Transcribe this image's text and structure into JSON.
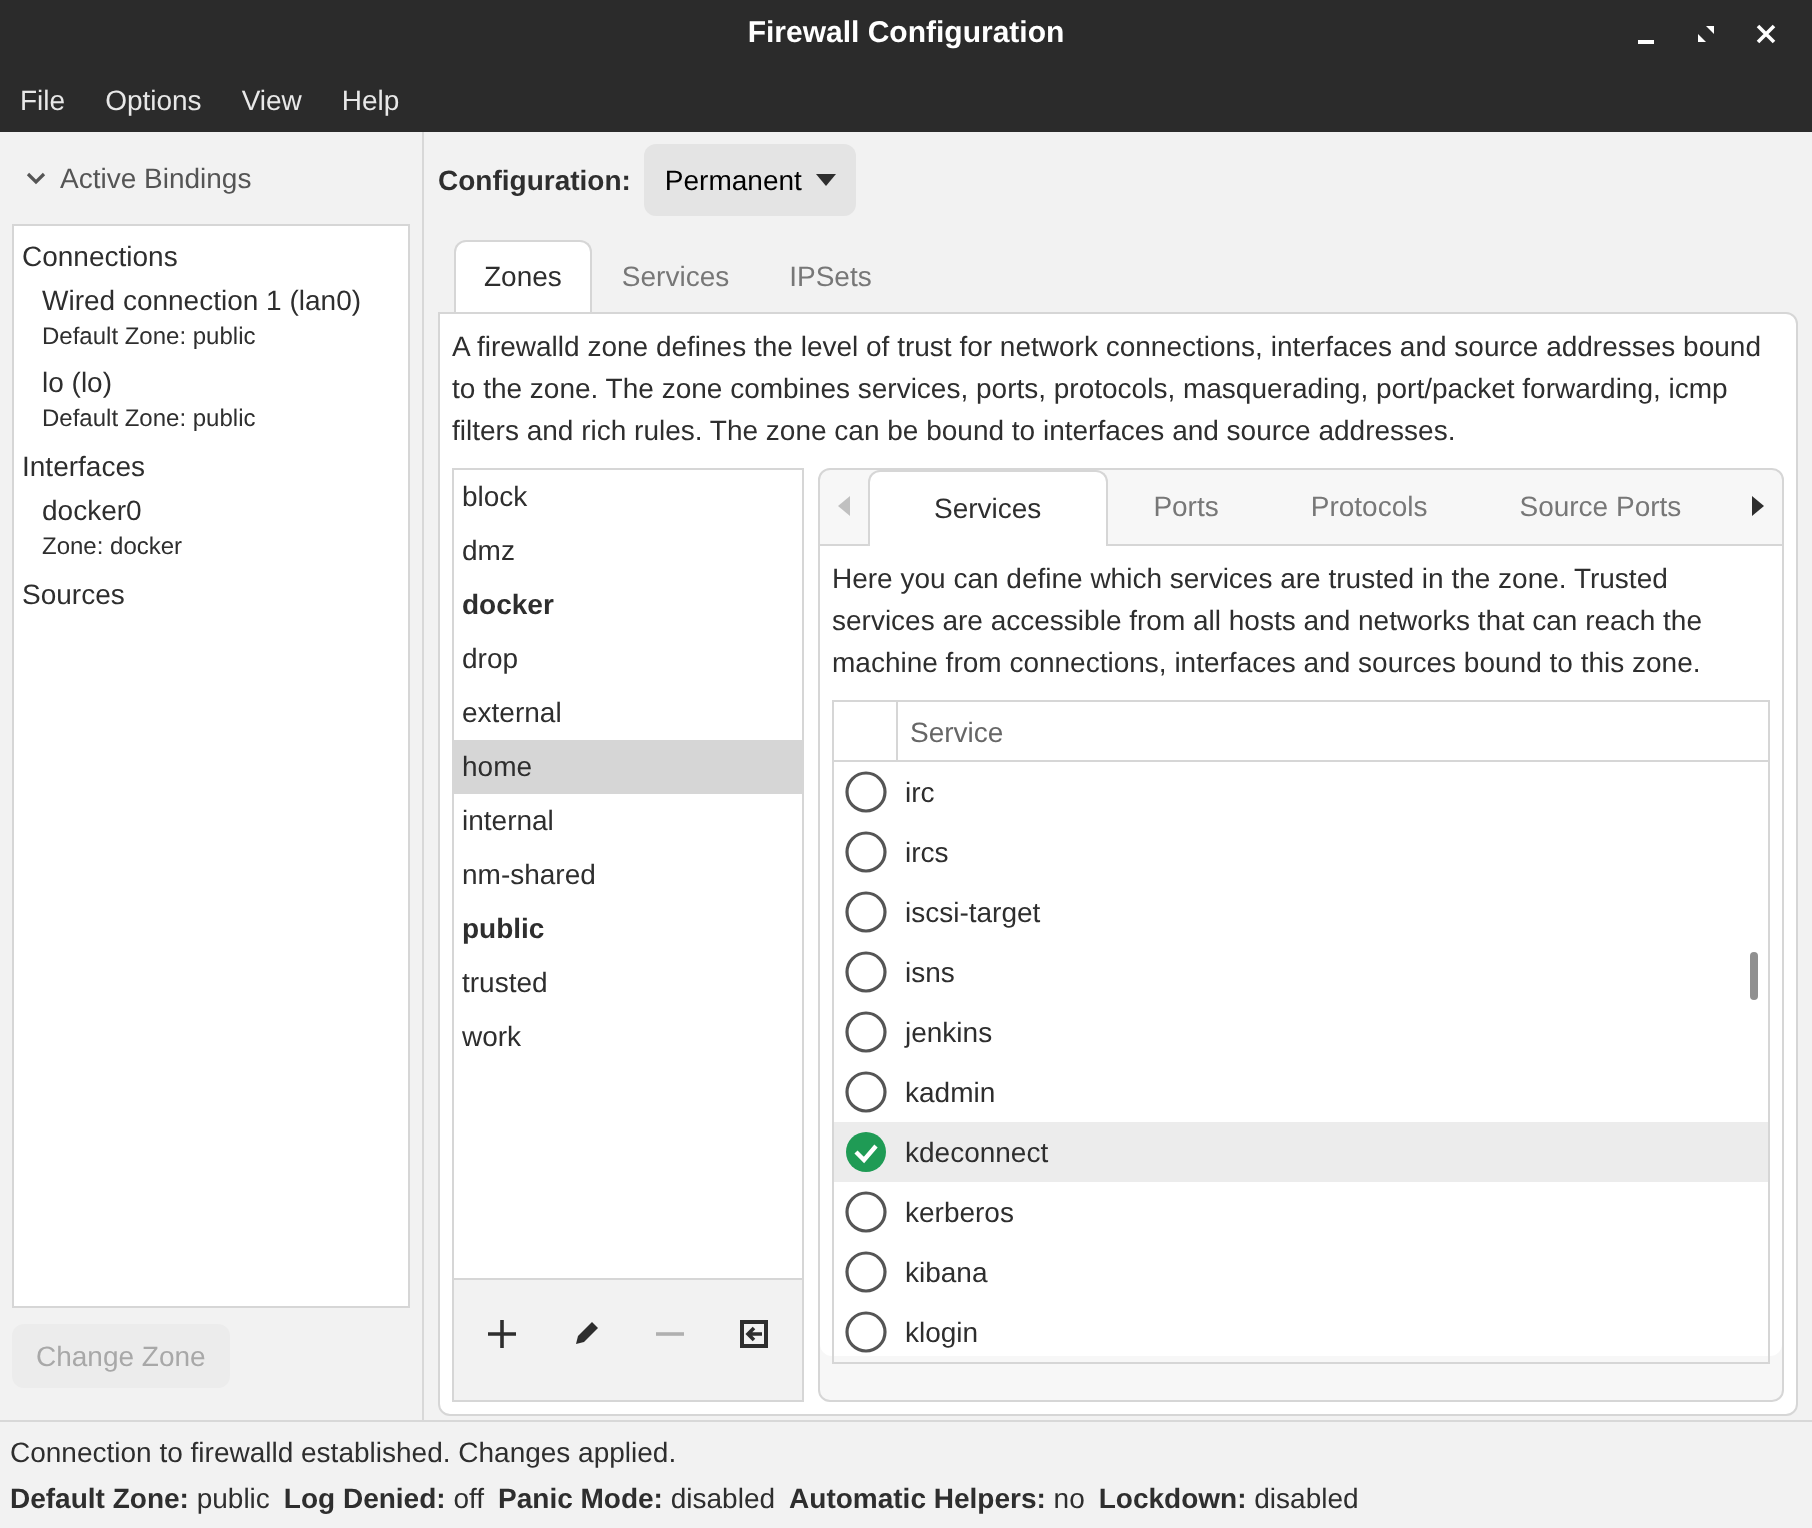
{
  "window": {
    "title": "Firewall Configuration"
  },
  "menu": [
    "File",
    "Options",
    "View",
    "Help"
  ],
  "bindings": {
    "title": "Active Bindings",
    "expanded": true,
    "sections": [
      {
        "heading": "Connections",
        "items": [
          {
            "name": "Wired connection 1 (lan0)",
            "detail": "Default Zone: public"
          },
          {
            "name": "lo (lo)",
            "detail": "Default Zone: public"
          }
        ]
      },
      {
        "heading": "Interfaces",
        "items": [
          {
            "name": "docker0",
            "detail": "Zone: docker"
          }
        ]
      },
      {
        "heading": "Sources"
      }
    ],
    "change_zone_button": {
      "label": "Change Zone",
      "disabled": true
    }
  },
  "configuration": {
    "label": "Configuration:",
    "value": "Permanent"
  },
  "tabs": [
    {
      "label": "Zones",
      "selected": true
    },
    {
      "label": "Services",
      "selected": false
    },
    {
      "label": "IPSets",
      "selected": false
    }
  ],
  "zones_description": "A firewalld zone defines the level of trust for network connections, interfaces and source addresses bound to the zone. The zone combines services, ports, protocols, masquerading, port/packet forwarding, icmp filters and rich rules. The zone can be bound to interfaces and source addresses.",
  "zones": [
    {
      "name": "block",
      "active": false,
      "selected": false
    },
    {
      "name": "dmz",
      "active": false,
      "selected": false
    },
    {
      "name": "docker",
      "active": true,
      "selected": false
    },
    {
      "name": "drop",
      "active": false,
      "selected": false
    },
    {
      "name": "external",
      "active": false,
      "selected": false
    },
    {
      "name": "home",
      "active": false,
      "selected": true
    },
    {
      "name": "internal",
      "active": false,
      "selected": false
    },
    {
      "name": "nm-shared",
      "active": false,
      "selected": false
    },
    {
      "name": "public",
      "active": true,
      "selected": false
    },
    {
      "name": "trusted",
      "active": false,
      "selected": false
    },
    {
      "name": "work",
      "active": false,
      "selected": false
    }
  ],
  "zone_tools": [
    {
      "kind": "add",
      "disabled": false
    },
    {
      "kind": "edit",
      "disabled": false
    },
    {
      "kind": "remove",
      "disabled": true
    },
    {
      "kind": "load",
      "disabled": false
    }
  ],
  "zone_tabs": [
    {
      "label": "Services",
      "selected": true
    },
    {
      "label": "Ports",
      "selected": false
    },
    {
      "label": "Protocols",
      "selected": false
    },
    {
      "label": "Source Ports",
      "selected": false
    }
  ],
  "services": {
    "description": "Here you can define which services are trusted in the zone. Trusted services are accessible from all hosts and networks that can reach the machine from connections, interfaces and sources bound to this zone.",
    "column": "Service",
    "rows": [
      {
        "name": "irc",
        "checked": false,
        "selected": false
      },
      {
        "name": "ircs",
        "checked": false,
        "selected": false
      },
      {
        "name": "iscsi-target",
        "checked": false,
        "selected": false
      },
      {
        "name": "isns",
        "checked": false,
        "selected": false
      },
      {
        "name": "jenkins",
        "checked": false,
        "selected": false
      },
      {
        "name": "kadmin",
        "checked": false,
        "selected": false
      },
      {
        "name": "kdeconnect",
        "checked": true,
        "selected": true
      },
      {
        "name": "kerberos",
        "checked": false,
        "selected": false
      },
      {
        "name": "kibana",
        "checked": false,
        "selected": false
      },
      {
        "name": "klogin",
        "checked": false,
        "selected": false
      }
    ]
  },
  "status_bar": {
    "message": "Connection to firewalld established.  Changes applied.",
    "fields": [
      {
        "label": "Default Zone:",
        "value": "public"
      },
      {
        "label": "Log Denied:",
        "value": "off"
      },
      {
        "label": "Panic Mode:",
        "value": "disabled"
      },
      {
        "label": "Automatic Helpers:",
        "value": "no"
      },
      {
        "label": "Lockdown:",
        "value": "disabled"
      }
    ]
  }
}
